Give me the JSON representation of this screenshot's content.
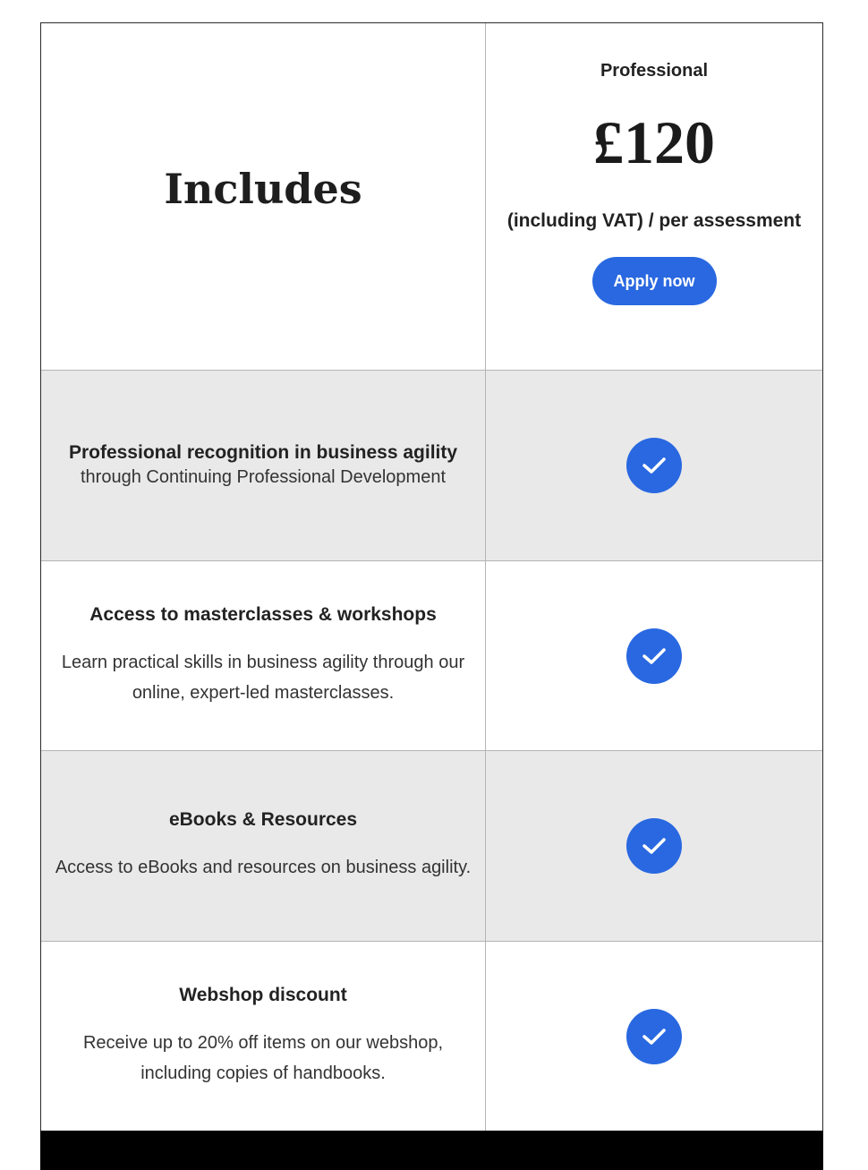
{
  "header": {
    "includes_title": "Includes",
    "plan_name": "Professional",
    "price": "£120",
    "price_note": "(including VAT) / per assessment",
    "apply_label": "Apply now"
  },
  "features": [
    {
      "title": "Professional recognition in business agility",
      "description": "through Continuing Professional Development",
      "included": true
    },
    {
      "title": "Access to masterclasses & workshops",
      "description": "Learn practical skills in business agility through our online, expert-led masterclasses.",
      "included": true
    },
    {
      "title": "eBooks & Resources",
      "description": "Access to eBooks and resources on business agility.",
      "included": true
    },
    {
      "title": "Webshop discount",
      "description": "Receive up to 20% off items on our webshop, including copies of handbooks.",
      "included": true
    }
  ],
  "colors": {
    "accent": "#2968e0",
    "row_grey": "#e9e9e9",
    "footer": "#000000"
  },
  "icons": {
    "included": "check-circle-icon"
  }
}
